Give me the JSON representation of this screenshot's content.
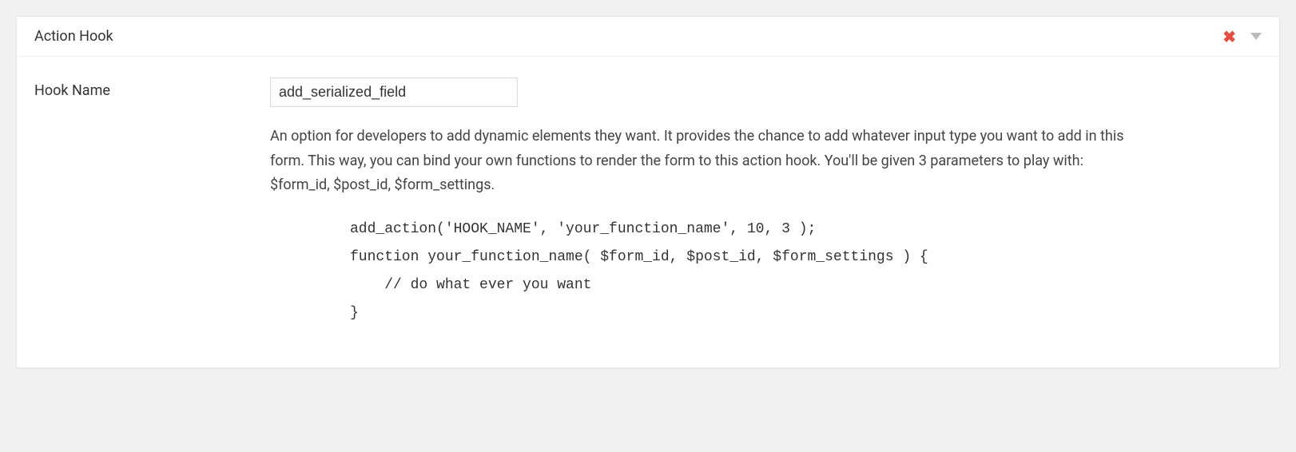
{
  "panel": {
    "title": "Action Hook"
  },
  "field": {
    "label": "Hook Name",
    "value": "add_serialized_field"
  },
  "description": "An option for developers to add dynamic elements they want. It provides the chance to add whatever input type you want to add in this form. This way, you can bind your own functions to render the form to this action hook. You'll be given 3 parameters to play with: $form_id, $post_id, $form_settings.",
  "code": "add_action('HOOK_NAME', 'your_function_name', 10, 3 );\nfunction your_function_name( $form_id, $post_id, $form_settings ) {\n    // do what ever you want\n}"
}
